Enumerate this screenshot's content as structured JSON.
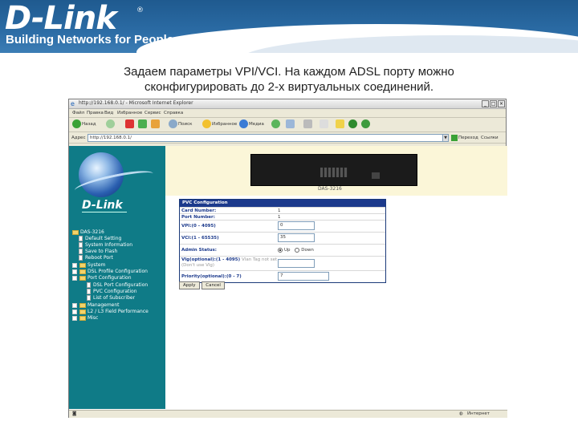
{
  "header": {
    "logo": "D-Link",
    "logo_mark": "®",
    "tagline": "Building Networks for People"
  },
  "caption": {
    "line1": "Задаем параметры VPI/VCI. На каждом ADSL порту можно",
    "line2": "сконфигурировать до 2-х виртуальных соединений."
  },
  "browser": {
    "title": "http://192.168.0.1/ - Microsoft Internet Explorer",
    "menu": [
      "Файл",
      "Правка",
      "Вид",
      "Избранное",
      "Сервис",
      "Справка"
    ],
    "toolbar": {
      "back": "Назад",
      "search": "Поиск",
      "favorites": "Избранное",
      "media": "Медиа"
    },
    "address_label": "Адрес",
    "address": "http://192.168.0.1/",
    "go": "Переход",
    "links": "Ссылки",
    "status_left": "",
    "status_right": "Интернет"
  },
  "panel": {
    "logo": "D-Link",
    "tree": [
      {
        "label": "DAS-3216",
        "type": "root"
      },
      {
        "label": "Default Setting",
        "type": "doc"
      },
      {
        "label": "System Information",
        "type": "doc"
      },
      {
        "label": "Save to Flash",
        "type": "doc"
      },
      {
        "label": "Reboot Port",
        "type": "doc"
      },
      {
        "label": "System",
        "type": "folder"
      },
      {
        "label": "DSL Profile Configuration",
        "type": "folder"
      },
      {
        "label": "Port Configuration",
        "type": "folder-open"
      },
      {
        "label": "DSL Port Configuration",
        "type": "doc"
      },
      {
        "label": "PVC Configuration",
        "type": "doc"
      },
      {
        "label": "List of Subscriber",
        "type": "doc"
      },
      {
        "label": "Management",
        "type": "folder"
      },
      {
        "label": "L2 / L3 Field Performance",
        "type": "folder"
      },
      {
        "label": "Misc",
        "type": "folder"
      }
    ]
  },
  "device": {
    "label": "DAS-3216"
  },
  "pvc": {
    "header": "PVC Configuration",
    "rows": {
      "card_number": {
        "label": "Card Number:",
        "value": "1"
      },
      "port_number": {
        "label": "Port Number:",
        "value": "1"
      },
      "vpi": {
        "label": "VPI:(0 - 4095)",
        "value": "0"
      },
      "vci": {
        "label": "VCI:(1 - 65535)",
        "value": "35"
      },
      "admin_status": {
        "label": "Admin Status:",
        "up": "Up",
        "down": "Down",
        "selected": "Up"
      },
      "vlan": {
        "label": "Vlg(optional):(1 - 4095)",
        "note": "Vlan Tag not set (Don't use Vlg)",
        "value": ""
      },
      "priority": {
        "label": "Priority(optional):(0 - 7)",
        "value": "7"
      }
    },
    "apply": "Apply",
    "cancel": "Cancel"
  },
  "colors": {
    "banner": "#2a6aa3",
    "panel": "#0f7b87",
    "table_header": "#1c3a8c",
    "device_bg": "#fbf6d8"
  }
}
